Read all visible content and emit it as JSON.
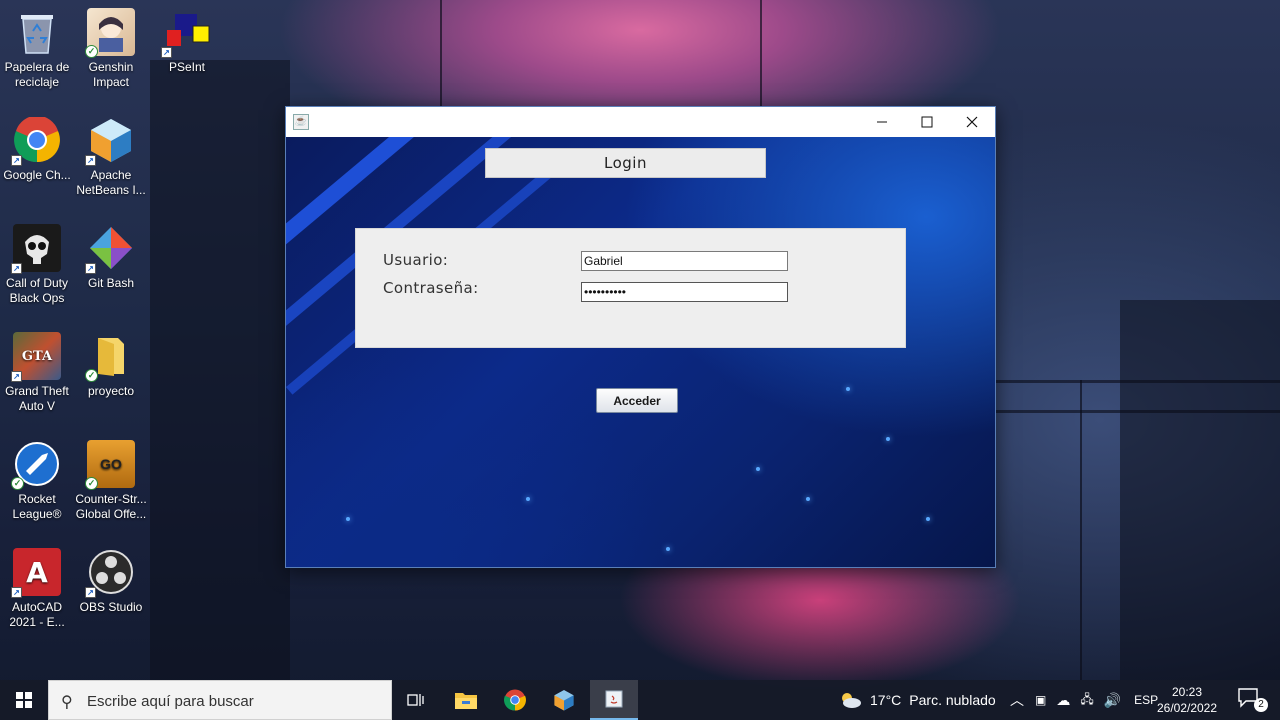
{
  "desktop": {
    "icons": [
      {
        "label": "Papelera de reciclaje",
        "icon": "recycle-bin-icon"
      },
      {
        "label": "Genshin Impact",
        "icon": "genshin-impact-icon"
      },
      {
        "label": "PSeInt",
        "icon": "pseint-icon"
      },
      {
        "label": "Google Ch...",
        "icon": "chrome-icon"
      },
      {
        "label": "Apache NetBeans I...",
        "icon": "netbeans-icon"
      },
      {
        "label": "Call of Duty Black Ops",
        "icon": "call-of-duty-icon"
      },
      {
        "label": "Git Bash",
        "icon": "git-bash-icon"
      },
      {
        "label": "Grand Theft Auto V",
        "icon": "gta-v-icon"
      },
      {
        "label": "proyecto",
        "icon": "folder-icon"
      },
      {
        "label": "Rocket League®",
        "icon": "rocket-league-icon"
      },
      {
        "label": "Counter-Str... Global Offe...",
        "icon": "csgo-icon"
      },
      {
        "label": "AutoCAD 2021 - E...",
        "icon": "autocad-icon"
      },
      {
        "label": "OBS Studio",
        "icon": "obs-icon"
      }
    ]
  },
  "window": {
    "title": "",
    "controls": {
      "minimize": "minimize-icon",
      "maximize": "maximize-icon",
      "close": "close-icon"
    },
    "login_title": "Login",
    "usuario_label": "Usuario:",
    "usuario_value": "Gabriel",
    "password_label": "Contraseña:",
    "password_value": "••••••••••",
    "submit_label": "Acceder"
  },
  "taskbar": {
    "search_placeholder": "Escribe aquí para buscar",
    "apps": [
      "task-view-icon",
      "file-explorer-icon",
      "chrome-icon",
      "netbeans-icon",
      "java-icon"
    ],
    "weather_temp": "17°C",
    "weather_desc": "Parc. nublado",
    "language": "ESP",
    "time": "20:23",
    "date": "26/02/2022",
    "notification_count": "2"
  },
  "colors": {
    "window_border": "#5a7fb8",
    "content_blue": "#0c2a8a",
    "accent_blue": "#1e4fd6",
    "taskbar": "#161a28"
  }
}
